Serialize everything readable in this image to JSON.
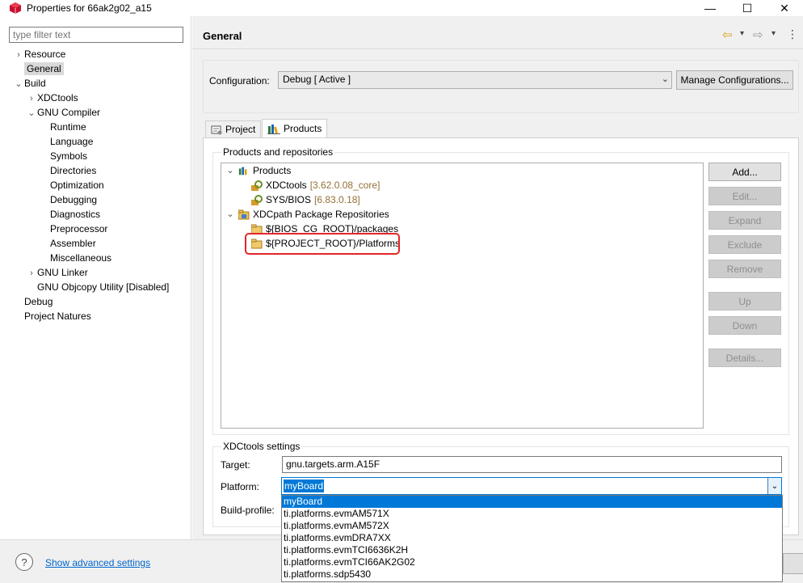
{
  "window": {
    "title": "Properties for 66ak2g02_a15",
    "minimize": "—",
    "maximize": "☐",
    "close": "✕"
  },
  "filter": {
    "placeholder": "type filter text"
  },
  "nav_tree": [
    {
      "label": "Resource",
      "indent": 0,
      "chevron": "›"
    },
    {
      "label": "General",
      "indent": 0,
      "chevron": "",
      "selected": true
    },
    {
      "label": "Build",
      "indent": 0,
      "chevron": "⌄"
    },
    {
      "label": "XDCtools",
      "indent": 1,
      "chevron": "›"
    },
    {
      "label": "GNU Compiler",
      "indent": 1,
      "chevron": "⌄"
    },
    {
      "label": "Runtime",
      "indent": 2,
      "chevron": ""
    },
    {
      "label": "Language",
      "indent": 2,
      "chevron": ""
    },
    {
      "label": "Symbols",
      "indent": 2,
      "chevron": ""
    },
    {
      "label": "Directories",
      "indent": 2,
      "chevron": ""
    },
    {
      "label": "Optimization",
      "indent": 2,
      "chevron": ""
    },
    {
      "label": "Debugging",
      "indent": 2,
      "chevron": ""
    },
    {
      "label": "Diagnostics",
      "indent": 2,
      "chevron": ""
    },
    {
      "label": "Preprocessor",
      "indent": 2,
      "chevron": ""
    },
    {
      "label": "Assembler",
      "indent": 2,
      "chevron": ""
    },
    {
      "label": "Miscellaneous",
      "indent": 2,
      "chevron": ""
    },
    {
      "label": "GNU Linker",
      "indent": 1,
      "chevron": "›"
    },
    {
      "label": "GNU Objcopy Utility  [Disabled]",
      "indent": 1,
      "chevron": ""
    },
    {
      "label": "Debug",
      "indent": 0,
      "chevron": ""
    },
    {
      "label": "Project Natures",
      "indent": 0,
      "chevron": ""
    }
  ],
  "page": {
    "title": "General",
    "back_icon": "⇦",
    "forward_icon": "⇨",
    "menu_icon": "⋮",
    "dropdown_icon": "▾"
  },
  "configuration": {
    "label": "Configuration:",
    "value": "Debug  [ Active ]",
    "manage_button": "Manage Configurations..."
  },
  "tabs": [
    {
      "label": "Project",
      "active": false
    },
    {
      "label": "Products",
      "active": true
    }
  ],
  "products_group": {
    "legend": "Products and repositories",
    "products_label": "Products",
    "xdctools": {
      "name": "XDCtools",
      "version": "[3.62.0.08_core]"
    },
    "sysbios": {
      "name": "SYS/BIOS",
      "version": "[6.83.0.18]"
    },
    "repos_label": "XDCpath Package Repositories",
    "repo_1": "${BIOS_CG_ROOT}/packages",
    "repo_2": "${PROJECT_ROOT}/Platforms"
  },
  "side_buttons": {
    "add": "Add...",
    "edit": "Edit...",
    "expand": "Expand",
    "exclude": "Exclude",
    "remove": "Remove",
    "up": "Up",
    "down": "Down",
    "details": "Details..."
  },
  "xdc_settings": {
    "legend": "XDCtools settings",
    "target_label": "Target:",
    "target_value": "gnu.targets.arm.A15F",
    "platform_label": "Platform:",
    "platform_value": "myBoard",
    "build_profile_label": "Build-profile:",
    "platform_options": [
      "myBoard",
      "ti.platforms.evmAM571X",
      "ti.platforms.evmAM572X",
      "ti.platforms.evmDRA7XX",
      "ti.platforms.evmTCI6636K2H",
      "ti.platforms.evmTCI66AK2G02",
      "ti.platforms.sdp5430"
    ]
  },
  "bottom": {
    "help_icon": "?",
    "advanced_link": "Show advanced settings"
  },
  "colors": {
    "selection": "#0078d7",
    "highlight_box": "#e3262b",
    "version_text": "#946f36",
    "link": "#0066cc"
  }
}
